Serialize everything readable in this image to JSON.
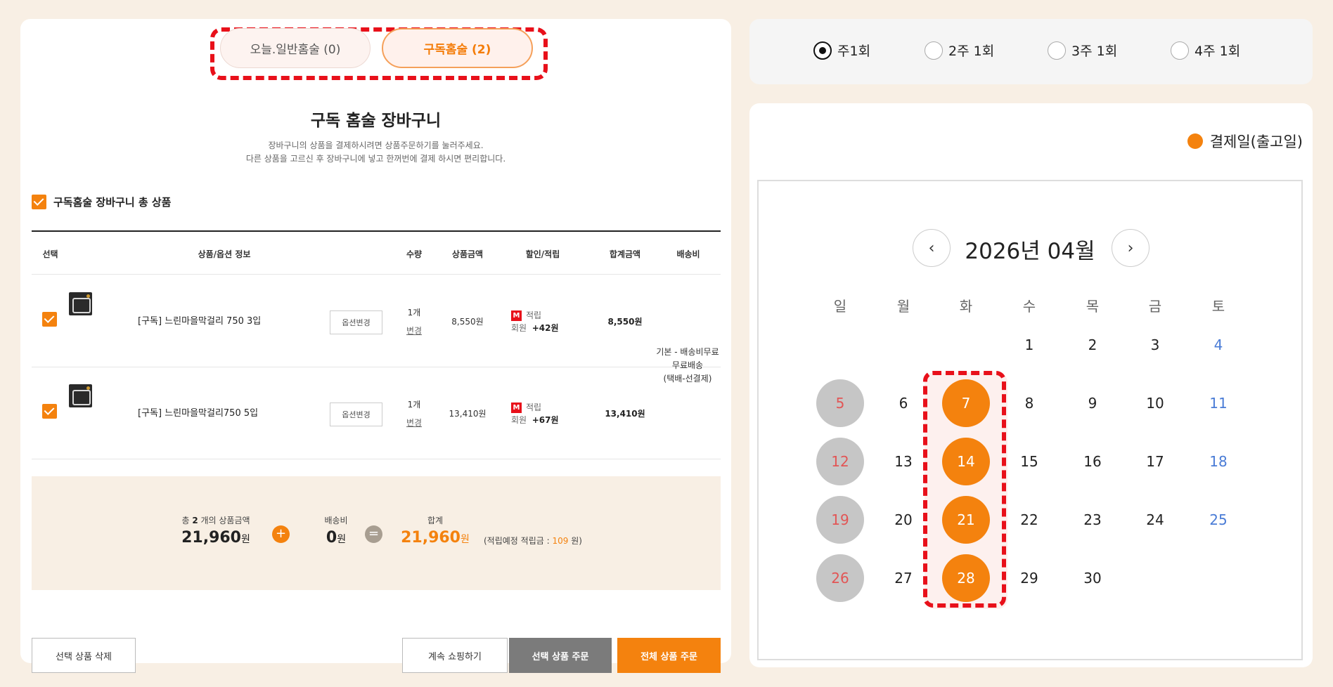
{
  "tabs": {
    "general": "오늘.일반홈술 (0)",
    "subscription": "구독홈술 (2)"
  },
  "cart": {
    "title": "구독 홈술 장바구니",
    "desc_line1": "장바구니의 상품을 결제하시려면 상품주문하기를 눌러주세요.",
    "desc_line2": "다른 상품을 고르신 후 장바구니에 넣고 한꺼번에 결제 하시면 편리합니다.",
    "all_check_label": "구독홈술 장바구니 총 상품"
  },
  "table": {
    "headers": {
      "select": "선택",
      "product": "상품/옵션 정보",
      "qty": "수량",
      "price": "상품금액",
      "discount": "할인/적립",
      "total": "합계금액",
      "shipping": "배송비"
    },
    "rows": [
      {
        "name": "[구독] 느린마을막걸리 750 3입",
        "option_button": "옵션변경",
        "qty": "1개",
        "qty_change": "변경",
        "price": "8,550원",
        "badge": "M",
        "reward_label": "적립",
        "member_label": "회원",
        "member_reward": "+42원",
        "total": "8,550원"
      },
      {
        "name": "[구독] 느린마을막걸리750 5입",
        "option_button": "옵션변경",
        "qty": "1개",
        "qty_change": "변경",
        "price": "13,410원",
        "badge": "M",
        "reward_label": "적립",
        "member_label": "회원",
        "member_reward": "+67원",
        "total": "13,410원"
      }
    ],
    "shipping": {
      "line1": "기본 - 배송비무료",
      "line2": "무료배송",
      "line3": "(택배-선결제)"
    }
  },
  "summary": {
    "total_prefix": "총",
    "total_count": "2",
    "total_suffix": "개의 상품금액",
    "total_amount": "21,960",
    "won": "원",
    "plus": "+",
    "shipping_label": "배송비",
    "shipping_amount": "0",
    "equals": "=",
    "grand_label": "합계",
    "grand_amount": "21,960",
    "reserve_prefix": "(적립예정 적립금 :",
    "reserve_value": "109",
    "reserve_suffix": "원)"
  },
  "buttons": {
    "delete_selected": "선택 상품 삭제",
    "continue_shopping": "계속 쇼핑하기",
    "order_selected": "선택 상품 주문",
    "order_all": "전체 상품 주문"
  },
  "frequency": {
    "options": [
      "주1회",
      "2주 1회",
      "3주 1회",
      "4주 1회"
    ],
    "selected": "주1회"
  },
  "calendar": {
    "legend": "결제일(출고일)",
    "title": "2026년 04월",
    "prev_icon": "‹",
    "next_icon": "›",
    "weekdays": [
      "일",
      "월",
      "화",
      "수",
      "목",
      "금",
      "토"
    ],
    "days": [
      [
        "",
        "",
        "",
        "1",
        "2",
        "3",
        "4"
      ],
      [
        "5",
        "6",
        "7",
        "8",
        "9",
        "10",
        "11"
      ],
      [
        "12",
        "13",
        "14",
        "15",
        "16",
        "17",
        "18"
      ],
      [
        "19",
        "20",
        "21",
        "22",
        "23",
        "24",
        "25"
      ],
      [
        "26",
        "27",
        "28",
        "29",
        "30",
        "",
        ""
      ]
    ],
    "payment_days": [
      "7",
      "14",
      "21",
      "28"
    ],
    "past_days": [
      "5",
      "12",
      "19",
      "26"
    ],
    "colors": {
      "accent": "#f4820e",
      "past": "#c6c6c6",
      "sunday": "#e25555",
      "saturday": "#4a7cd6",
      "highlight_border": "#e8101a"
    }
  }
}
